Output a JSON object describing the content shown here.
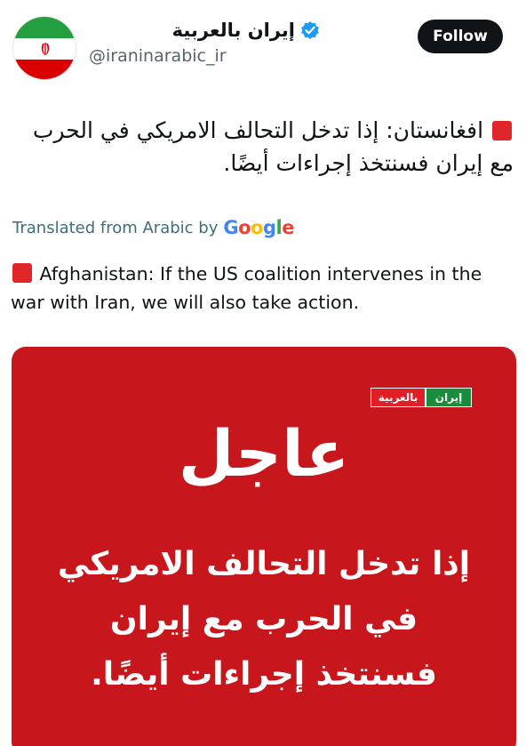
{
  "account": {
    "display_name": "إيران بالعربية",
    "handle": "@iraninarabic_ir",
    "verified_icon": "verified-badge-icon",
    "avatar": "iran-flag-avatar"
  },
  "actions": {
    "follow_label": "Follow"
  },
  "post": {
    "arabic_line1": "افغانستان: إذا تدخل التحالف الامريكي  في الحرب",
    "arabic_line2": "مع إيران فسنتخذ إجراءات أيضًا.",
    "translated_prefix": "Translated from Arabic by",
    "translated_brand": "Google",
    "english_line1": "Afghanistan: If the US coalition intervenes in the",
    "english_line2": "war with Iran, we will also take action."
  },
  "media": {
    "logo_left": "بالعربية",
    "logo_right": "إيران",
    "breaking_label": "عاجل",
    "headline_line1": "إذا تدخل التحالف الامريكي",
    "headline_line2": "في الحرب مع إيران",
    "headline_line3": "فسنتخذ إجراءات أيضًا."
  },
  "colors": {
    "follow_bg": "#0f1419",
    "card_red": "#c8161d",
    "square_red": "#e0262b",
    "verified_blue": "#1d9bf0"
  }
}
